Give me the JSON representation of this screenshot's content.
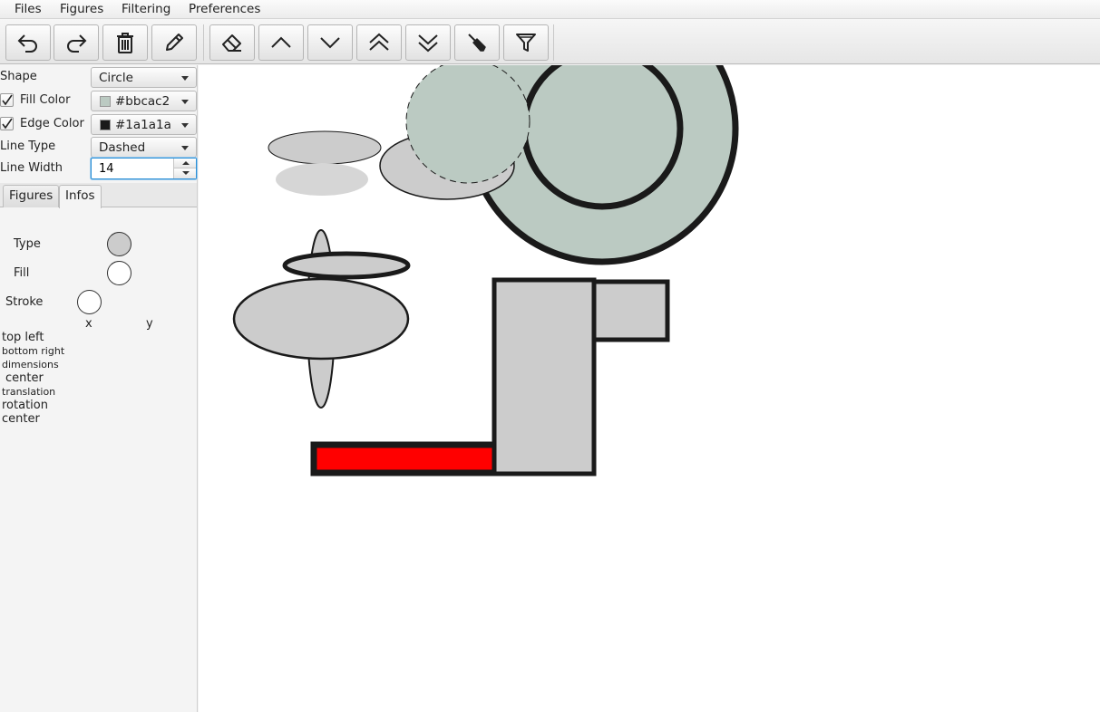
{
  "menu": {
    "files": "Files",
    "figures": "Figures",
    "filtering": "Filtering",
    "preferences": "Preferences"
  },
  "toolbar": {
    "buttons": [
      {
        "name": "undo",
        "icon": "undo-icon"
      },
      {
        "name": "redo",
        "icon": "redo-icon"
      },
      {
        "name": "delete",
        "icon": "trash-icon"
      },
      {
        "name": "edit",
        "icon": "pencil-icon"
      },
      {
        "name": "erase",
        "icon": "eraser-icon"
      },
      {
        "name": "move-up",
        "icon": "chevron-up-icon"
      },
      {
        "name": "move-down",
        "icon": "chevron-down-icon"
      },
      {
        "name": "move-top",
        "icon": "double-chevron-up-icon"
      },
      {
        "name": "move-bottom",
        "icon": "double-chevron-down-icon"
      },
      {
        "name": "pick-color",
        "icon": "eyedropper-icon"
      },
      {
        "name": "filter",
        "icon": "filter-icon"
      }
    ]
  },
  "properties": {
    "shape_label": "Shape",
    "shape_value": "Circle",
    "fill_label": "Fill Color",
    "fill_checked": true,
    "fill_value": "#bbcac2",
    "edge_label": "Edge Color",
    "edge_checked": true,
    "edge_value": "#1a1a1a",
    "linetype_label": "Line Type",
    "linetype_value": "Dashed",
    "linewidth_label": "Line Width",
    "linewidth_value": "14"
  },
  "tabs": {
    "figures": "Figures",
    "infos": "Infos",
    "active": "infos"
  },
  "infos": {
    "type_label": "Type",
    "fill_label": "Fill",
    "stroke_label": "Stroke",
    "x_label": "x",
    "y_label": "y",
    "top_left": "top left",
    "bottom_right": "bottom right",
    "dimensions": "dimensions",
    "center": "center",
    "translation": "translation",
    "rotation": "rotation",
    "rotation_center": "center"
  },
  "colors": {
    "fill_swatch": "#bbcac2",
    "edge_swatch": "#1a1a1a",
    "shape_gray": "#cccccc",
    "shape_light_gray": "#d6d6d6",
    "highlight_red": "#ff0000",
    "focus_blue": "#2a8fd6"
  }
}
